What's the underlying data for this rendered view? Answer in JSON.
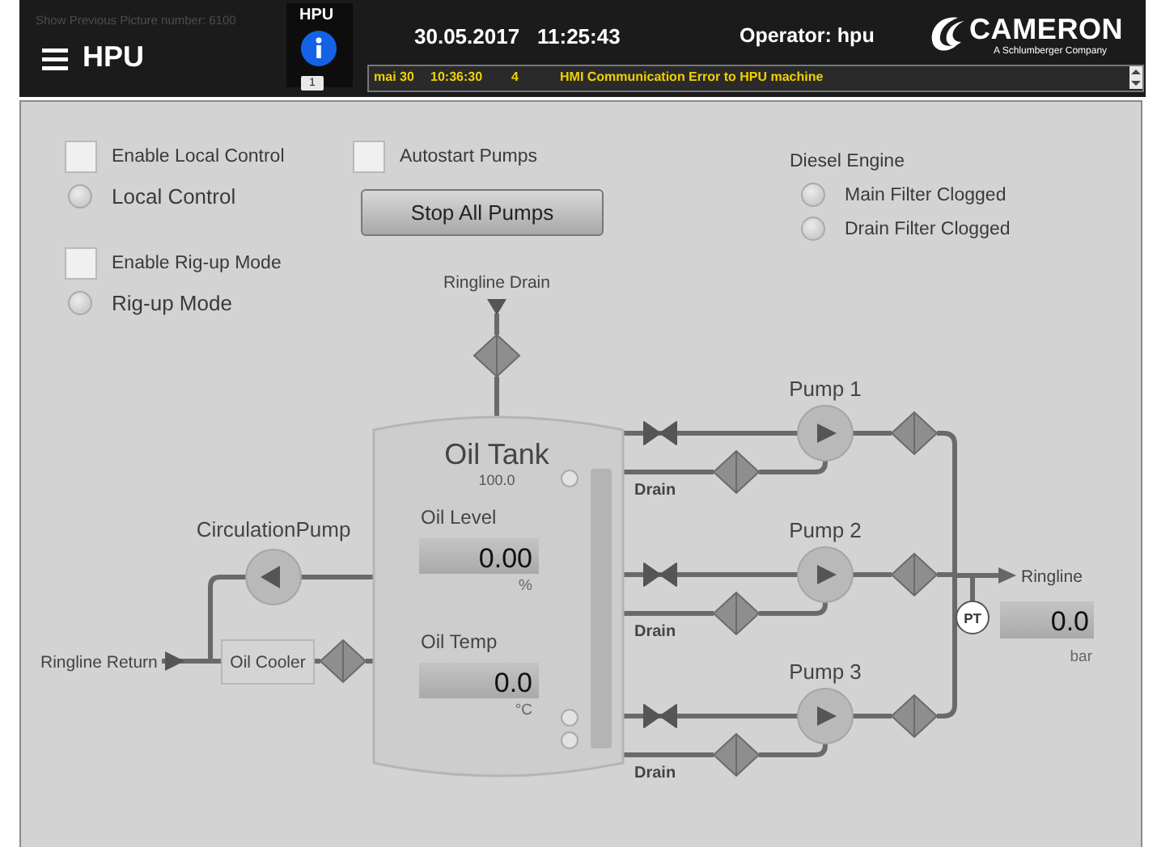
{
  "header": {
    "note": "Show Previous Picture number: 6100",
    "title": "HPU",
    "station_label": "HPU",
    "info_count": "1",
    "date": "30.05.2017",
    "time": "11:25:43",
    "operator": "Operator: hpu",
    "brand": "CAMERON",
    "brand_tagline": "A Schlumberger Company",
    "alarm": {
      "date": "mai 30",
      "time": "10:36:30",
      "priority": "4",
      "message": "HMI Communication Error to HPU machine"
    }
  },
  "left_controls": [
    {
      "kind": "checkbox",
      "label": "Enable Local Control",
      "checked": false
    },
    {
      "kind": "indicator",
      "label": "Local Control",
      "on": false
    },
    {
      "kind": "checkbox",
      "label": "Enable Rig-up Mode",
      "checked": false
    },
    {
      "kind": "indicator",
      "label": "Rig-up Mode",
      "on": false
    }
  ],
  "autostart": {
    "label": "Autostart Pumps",
    "checked": false
  },
  "stop_button": "Stop All Pumps",
  "diesel_engine": {
    "title": "Diesel Engine",
    "indicators": [
      {
        "label": "Main Filter Clogged",
        "on": false
      },
      {
        "label": "Drain Filter Clogged",
        "on": false
      }
    ]
  },
  "diagram": {
    "ringline_drain": "Ringline Drain",
    "ringline_return": "Ringline Return",
    "circulation_pump": "CirculationPump",
    "oil_cooler": "Oil Cooler",
    "tank": {
      "title": "Oil Tank",
      "capacity": "100.0",
      "oil_level": {
        "label": "Oil Level",
        "value": "0.00",
        "unit": "%"
      },
      "oil_temp": {
        "label": "Oil Temp",
        "value": "0.0",
        "unit": "°C"
      }
    },
    "pumps": [
      {
        "label": "Pump 1",
        "drain": "Drain"
      },
      {
        "label": "Pump 2",
        "drain": "Drain"
      },
      {
        "label": "Pump 3",
        "drain": "Drain"
      }
    ],
    "ringline": "Ringline",
    "pressure": {
      "sensor": "PT",
      "value": "0.0",
      "unit": "bar"
    }
  }
}
